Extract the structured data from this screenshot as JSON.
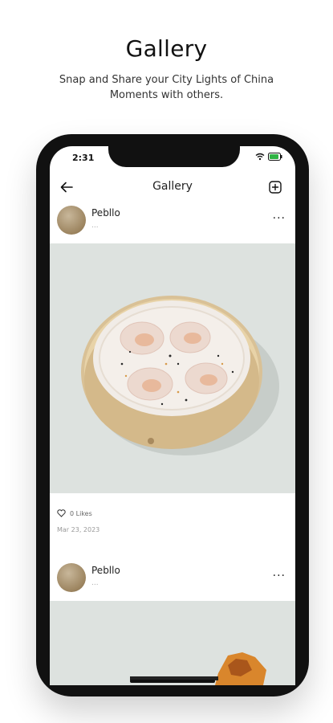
{
  "promo": {
    "title": "Gallery",
    "subtitle": "Snap and Share your City Lights of China Moments with others."
  },
  "status_bar": {
    "time": "2:31"
  },
  "header": {
    "title": "Gallery"
  },
  "posts": [
    {
      "username": "Pebllo",
      "subline": "...",
      "likes": "0 Likes",
      "date": "Mar 23, 2023"
    },
    {
      "username": "Pebllo",
      "subline": "..."
    }
  ],
  "icons": {
    "back": "arrow-left-icon",
    "add": "plus-square-icon",
    "more": "more-horizontal-icon",
    "like": "heart-icon"
  },
  "colors": {
    "image_bg": "#dde2df",
    "steamer": "#e6cfa2",
    "avatar": "#9c845f"
  }
}
